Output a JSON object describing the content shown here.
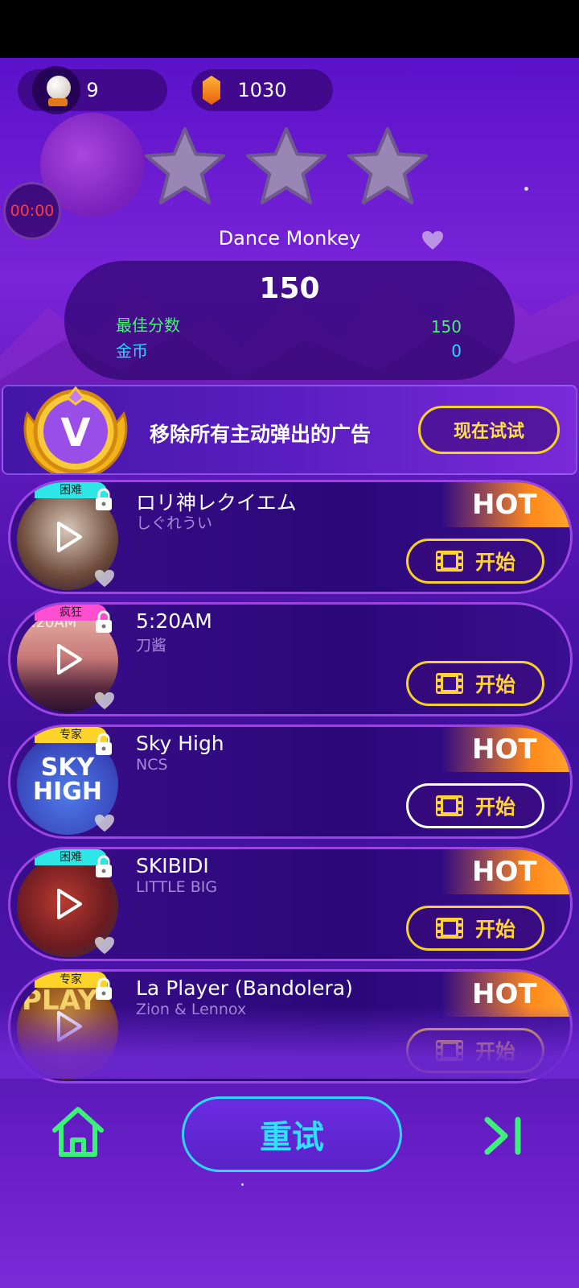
{
  "top": {
    "balls_count": "9",
    "gems_count": "1030",
    "timer": "00:00"
  },
  "result": {
    "song_title": "Dance Monkey",
    "score": "150",
    "best_label": "最佳分数",
    "best_value": "150",
    "coins_label": "金币",
    "coins_value": "0",
    "stars_earned": 0,
    "stars_total": 3
  },
  "vip": {
    "badge_letter": "V",
    "text": "移除所有主动弹出的广告",
    "button": "现在试试"
  },
  "songs": [
    {
      "title": "ロリ神レクイエム",
      "artist": "しぐれうい",
      "tag": "困难",
      "tag_color": "#2fe6e6",
      "hot": "HOT",
      "start": "开始"
    },
    {
      "title": "5:20AM",
      "artist": "刀酱",
      "tag": "疯狂",
      "tag_color": "#ff4fd0",
      "cover_text": "5:20AM",
      "start": "开始"
    },
    {
      "title": "Sky High",
      "artist": "NCS",
      "tag": "专家",
      "tag_color": "#ffd42a",
      "hot": "HOT",
      "cover_text": "SKY HIGH",
      "start": "开始"
    },
    {
      "title": "SKIBIDI",
      "artist": "LITTLE BIG",
      "tag": "困难",
      "tag_color": "#2fe6e6",
      "hot": "HOT",
      "start": "开始"
    },
    {
      "title": "La Player (Bandolera)",
      "artist": "Zion & Lennox",
      "tag": "专家",
      "tag_color": "#ffd42a",
      "hot": "HOT",
      "cover_text": "PLAY",
      "start": "开始"
    }
  ],
  "bottom": {
    "retry": "重试"
  },
  "colors": {
    "accent_gold": "#f5d22a",
    "accent_cyan": "#2ed8ff",
    "accent_green": "#49f07a",
    "hot_orange": "#ff8a1c"
  }
}
